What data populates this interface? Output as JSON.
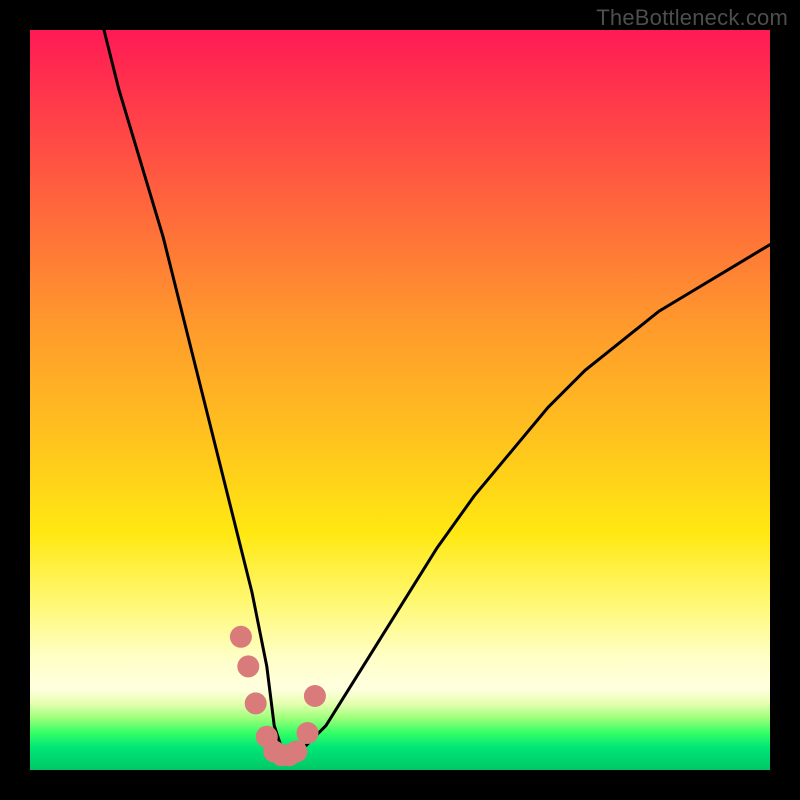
{
  "watermark": "TheBottleneck.com",
  "chart_data": {
    "type": "line",
    "title": "",
    "xlabel": "",
    "ylabel": "",
    "xlim": [
      0,
      100
    ],
    "ylim": [
      0,
      100
    ],
    "series": [
      {
        "name": "bottleneck-curve",
        "x": [
          10,
          12,
          15,
          18,
          20,
          22,
          24,
          26,
          28,
          30,
          32,
          33,
          34,
          36,
          40,
          45,
          50,
          55,
          60,
          65,
          70,
          75,
          80,
          85,
          90,
          95,
          100
        ],
        "values": [
          100,
          92,
          82,
          72,
          64,
          56,
          48,
          40,
          32,
          24,
          14,
          6,
          3,
          2,
          6,
          14,
          22,
          30,
          37,
          43,
          49,
          54,
          58,
          62,
          65,
          68,
          71
        ]
      }
    ],
    "markers": {
      "name": "highlight-points",
      "x": [
        28.5,
        29.5,
        30.5,
        32.0,
        33.0,
        34.0,
        35.0,
        36.0,
        37.5,
        38.5
      ],
      "values": [
        18.0,
        14.0,
        9.0,
        4.5,
        2.5,
        2.0,
        2.0,
        2.5,
        5.0,
        10.0
      ]
    },
    "gradient_stops": [
      {
        "pos": 0,
        "color": "#ff1a55"
      },
      {
        "pos": 25,
        "color": "#ff6a3b"
      },
      {
        "pos": 55,
        "color": "#ffc21e"
      },
      {
        "pos": 85,
        "color": "#ffffc8"
      },
      {
        "pos": 95,
        "color": "#33ff66"
      },
      {
        "pos": 100,
        "color": "#00c864"
      }
    ]
  }
}
